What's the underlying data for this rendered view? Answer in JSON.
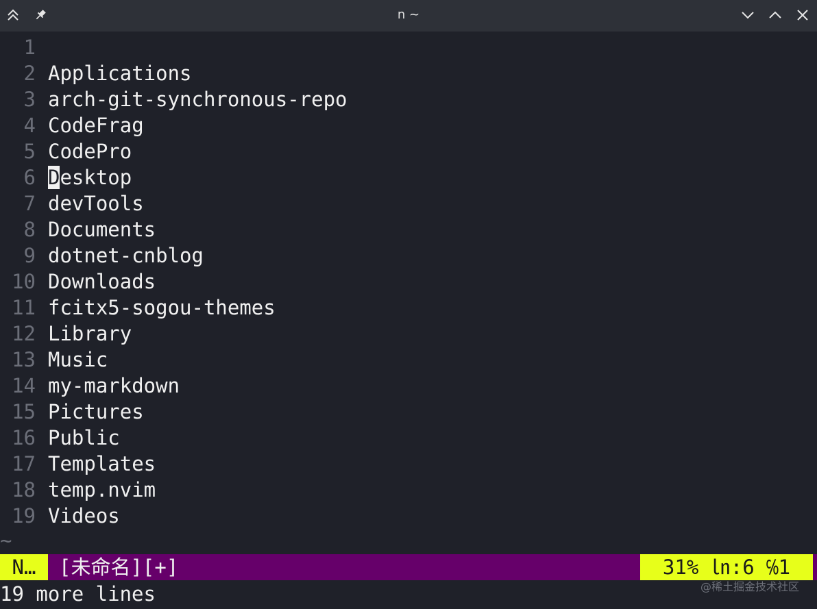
{
  "window": {
    "title": "n ~"
  },
  "editor": {
    "lines": [
      {
        "num": "1",
        "text": ""
      },
      {
        "num": "2",
        "text": "Applications"
      },
      {
        "num": "3",
        "text": "arch-git-synchronous-repo"
      },
      {
        "num": "4",
        "text": "CodeFrag"
      },
      {
        "num": "5",
        "text": "CodePro"
      },
      {
        "num": "6",
        "cursor_char": "D",
        "text": "esktop"
      },
      {
        "num": "7",
        "text": "devTools"
      },
      {
        "num": "8",
        "text": "Documents"
      },
      {
        "num": "9",
        "text": "dotnet-cnblog"
      },
      {
        "num": "10",
        "text": "Downloads"
      },
      {
        "num": "11",
        "text": "fcitx5-sogou-themes"
      },
      {
        "num": "12",
        "text": "Library"
      },
      {
        "num": "13",
        "text": "Music"
      },
      {
        "num": "14",
        "text": "my-markdown"
      },
      {
        "num": "15",
        "text": "Pictures"
      },
      {
        "num": "16",
        "text": "Public"
      },
      {
        "num": "17",
        "text": "Templates"
      },
      {
        "num": "18",
        "text": "temp.nvim"
      },
      {
        "num": "19",
        "text": "Videos"
      }
    ],
    "end_marker": "~"
  },
  "statusline": {
    "mode": "N…",
    "filename": "[未命名][+]",
    "position": "31% ㏑:6 ℅1"
  },
  "message": "19 more lines",
  "watermark": "@稀土掘金技术社区",
  "colors": {
    "background": "#1f2129",
    "titlebar": "#2e3138",
    "statusline": "#66006a",
    "mode_highlight": "#e7ff1a",
    "line_number": "#6b6e78",
    "text": "#f0f0f0"
  },
  "icons": {
    "keep_above": "double-chevron-up-icon",
    "pin": "pin-icon",
    "minimize": "chevron-down-icon",
    "maximize": "chevron-up-icon",
    "close": "close-icon"
  }
}
